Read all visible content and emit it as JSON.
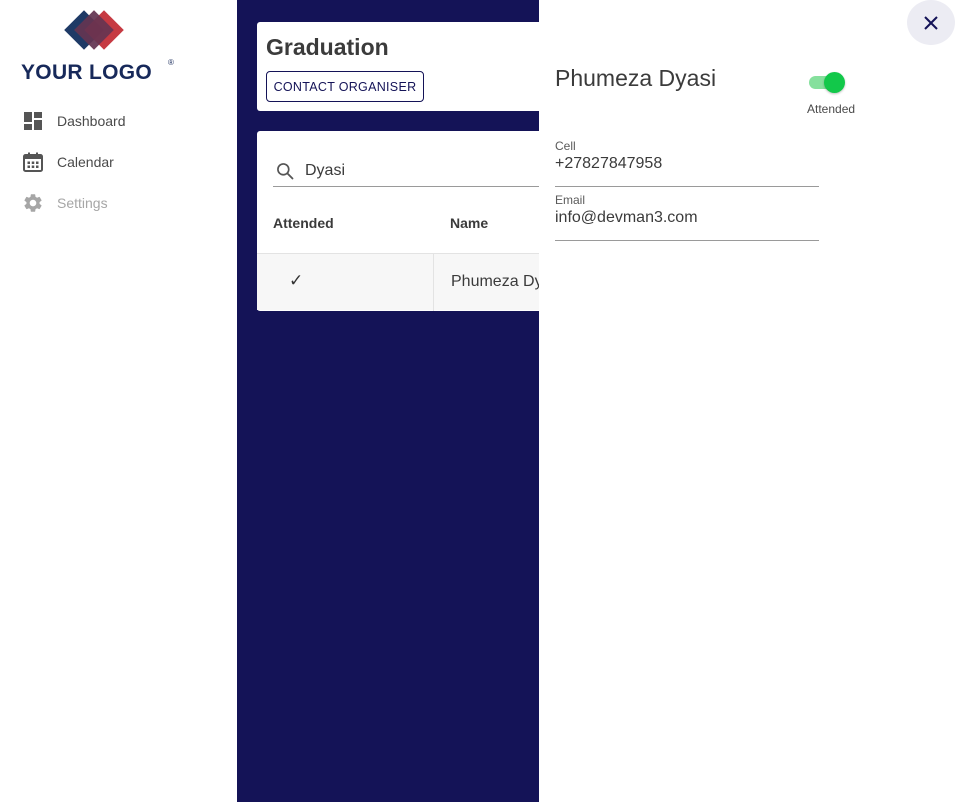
{
  "logo": {
    "text": "YOUR LOGO",
    "reg": "®"
  },
  "sidebar": {
    "items": [
      {
        "label": "Dashboard",
        "icon": "dashboard-icon",
        "disabled": false
      },
      {
        "label": "Calendar",
        "icon": "calendar-icon",
        "disabled": false
      },
      {
        "label": "Settings",
        "icon": "gear-icon",
        "disabled": true
      }
    ]
  },
  "main": {
    "title": "Graduation",
    "contact_button": "CONTACT ORGANISER",
    "search": {
      "value": "Dyasi",
      "icon": "search-icon"
    },
    "table": {
      "headers": [
        "Attended",
        "Name"
      ],
      "rows": [
        {
          "attended": "✓",
          "name": "Phumeza Dyasi"
        }
      ]
    }
  },
  "drawer": {
    "name": "Phumeza Dyasi",
    "toggle": {
      "label": "Attended",
      "on": true
    },
    "fields": [
      {
        "label": "Cell",
        "value": "+27827847958"
      },
      {
        "label": "Email",
        "value": "info@devman3.com"
      }
    ],
    "close_icon": "close-icon"
  },
  "colors": {
    "main_bg": "#141357",
    "toggle_on": "#12c84a",
    "toggle_track": "#86e09d",
    "logo_navy": "#17295a",
    "logo_red": "#b5272f"
  }
}
